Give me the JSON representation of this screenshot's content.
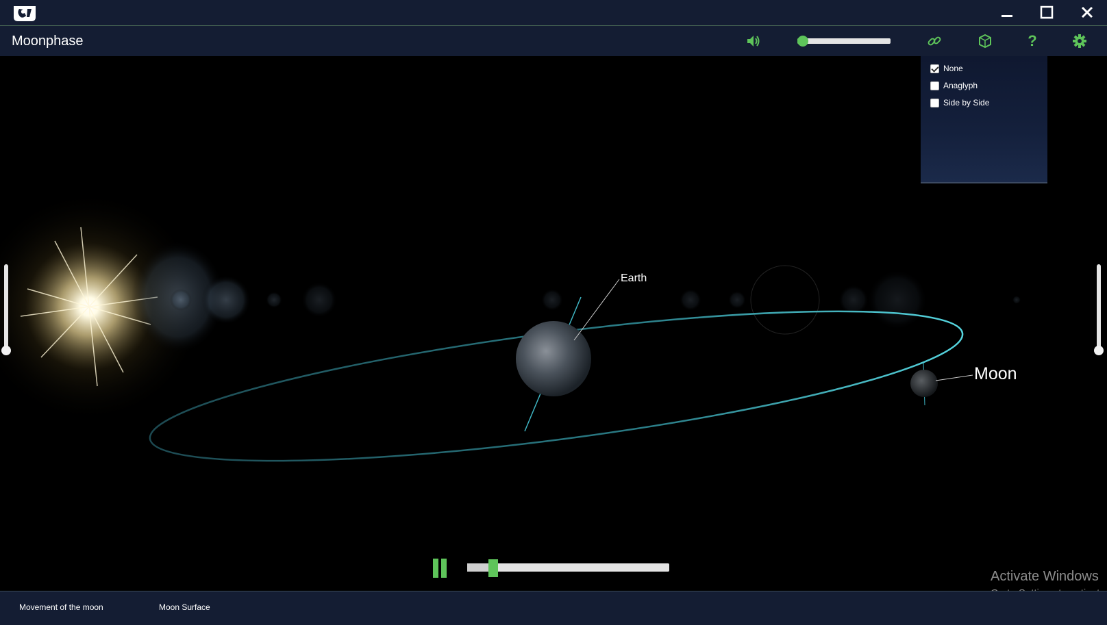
{
  "app": {
    "title": "Moonphase"
  },
  "window_controls": {
    "minimize": "minimize-icon",
    "maximize": "maximize-icon",
    "close": "close-icon"
  },
  "toolbar": {
    "icons": [
      "speaker-icon",
      "link-icon",
      "3d-cube-icon",
      "help-icon",
      "gear-icon"
    ],
    "volume": {
      "value": 0.05
    },
    "help_label": "?"
  },
  "stereo_menu": {
    "options": [
      {
        "label": "None",
        "checked": true
      },
      {
        "label": "Anaglyph",
        "checked": false
      },
      {
        "label": "Side by Side",
        "checked": false
      }
    ]
  },
  "scene": {
    "earth_label": "Earth",
    "moon_label": "Moon",
    "left_slider": {
      "value": 0.0
    },
    "right_slider": {
      "value": 0.0
    }
  },
  "playback": {
    "state": "playing",
    "progress": 0.13
  },
  "bottom_tabs": [
    {
      "label": "Movement of the moon"
    },
    {
      "label": "Moon Surface"
    }
  ],
  "watermark": {
    "line1": "Activate Windows",
    "line2": "Go to Settings to activate"
  },
  "colors": {
    "accent": "#5ec45a",
    "bar": "#141d33",
    "orbit": "#3fb6c4"
  }
}
